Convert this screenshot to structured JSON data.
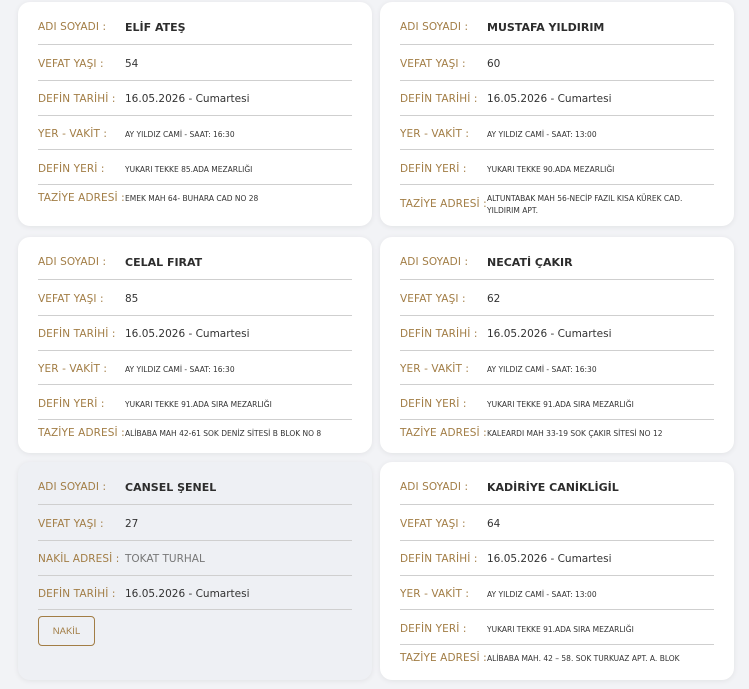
{
  "labels": {
    "name": "ADI SOYADI :",
    "age": "VEFAT YAŞI :",
    "date": "DEFİN TARİHİ :",
    "place_time": "YER - VAKİT :",
    "burial": "DEFİN YERİ :",
    "condolence": "TAZİYE ADRESİ :",
    "nakil": "NAKİL ADRESİ :"
  },
  "cards": [
    {
      "name": "ELİF ATEŞ",
      "age": "54",
      "date": "16.05.2026 - Cumartesi",
      "place_time": "AY YILDIZ CAMİ - SAAT: 16:30",
      "burial": "YUKARI TEKKE 85.ADA MEZARLIĞI",
      "condolence": "EMEK MAH 64- BUHARA CAD NO 28"
    },
    {
      "name": "MUSTAFA YILDIRIM",
      "age": "60",
      "date": "16.05.2026 - Cumartesi",
      "place_time": "AY YILDIZ CAMİ - SAAT: 13:00",
      "burial": "YUKARI TEKKE 90.ADA MEZARLIĞI",
      "condolence": "ALTUNTABAK MAH 56-NECİP FAZIL KISA KÜREK CAD. YILDIRIM APT."
    },
    {
      "name": "CELAL FIRAT",
      "age": "85",
      "date": "16.05.2026 - Cumartesi",
      "place_time": "AY YILDIZ CAMİ - SAAT: 16:30",
      "burial": "YUKARI TEKKE 91.ADA SIRA MEZARLIĞI",
      "condolence": "ALİBABA MAH 42-61 SOK DENİZ SİTESİ B BLOK NO 8"
    },
    {
      "name": "NECATİ ÇAKIR",
      "age": "62",
      "date": "16.05.2026 - Cumartesi",
      "place_time": "AY YILDIZ CAMİ - SAAT: 16:30",
      "burial": "YUKARI TEKKE 91.ADA SIRA MEZARLIĞI",
      "condolence": "KALEARDI MAH 33-19 SOK ÇAKIR SİTESİ NO 12"
    },
    {
      "name": "CANSEL ŞENEL",
      "age": "27",
      "nakil": "TOKAT TURHAL",
      "date": "16.05.2026 - Cumartesi",
      "button": "NAKİL"
    },
    {
      "name": "KADİRİYE CANİKLİGİL",
      "age": "64",
      "date": "16.05.2026 - Cumartesi",
      "place_time": "AY YILDIZ CAMİ - SAAT: 13:00",
      "burial": "YUKARI TEKKE 91.ADA SIRA MEZARLIĞI",
      "condolence": "ALİBABA MAH. 42 – 58. SOK TURKUAZ APT. A. BLOK"
    }
  ]
}
